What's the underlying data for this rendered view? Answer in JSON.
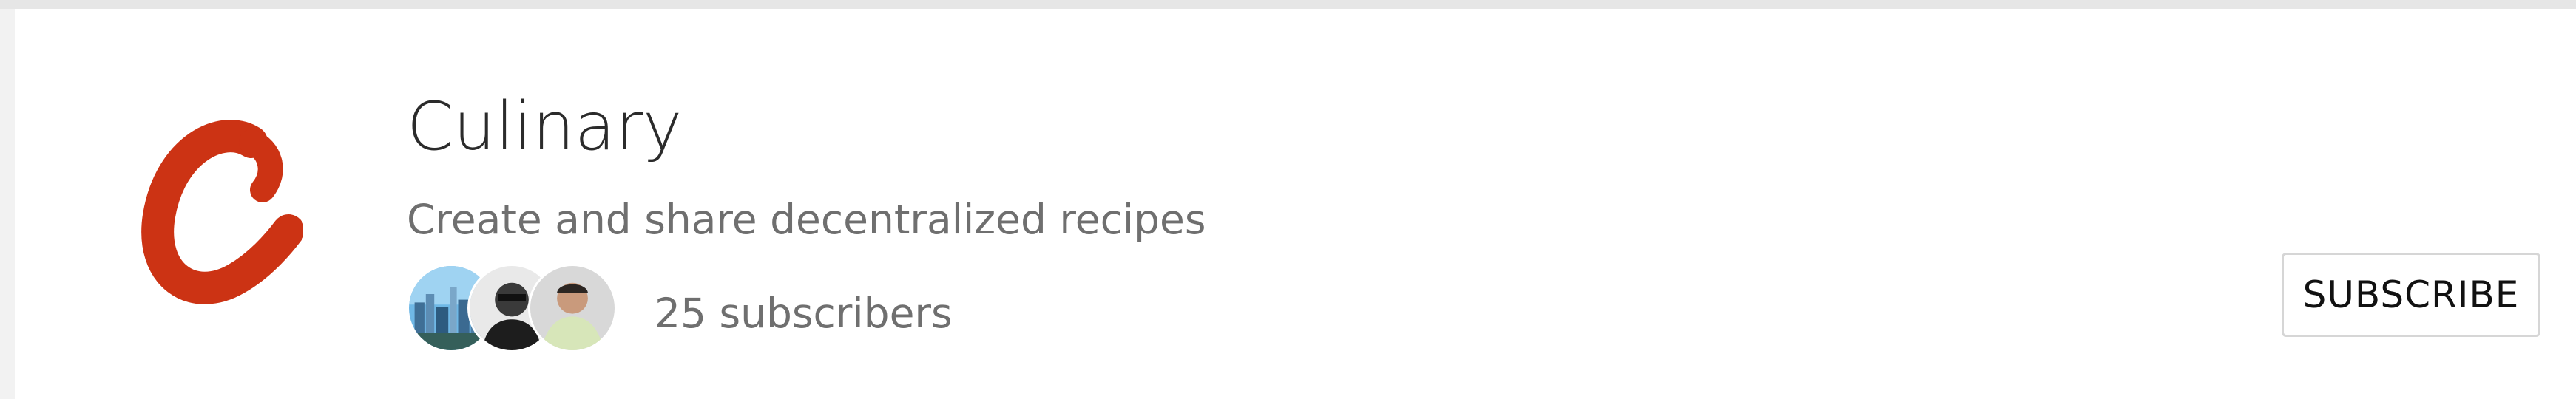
{
  "community": {
    "name": "Culinary",
    "description": "Create and share decentralized recipes",
    "logo_icon": "script-c-logo",
    "logo_color": "#cc3314",
    "subscriber_text": "25 subscribers",
    "subscribe_label": "SUBSCRIBE"
  },
  "subscribers_preview": [
    {
      "icon": "city-skyline-avatar"
    },
    {
      "icon": "person-dark-avatar"
    },
    {
      "icon": "person-light-avatar"
    }
  ]
}
